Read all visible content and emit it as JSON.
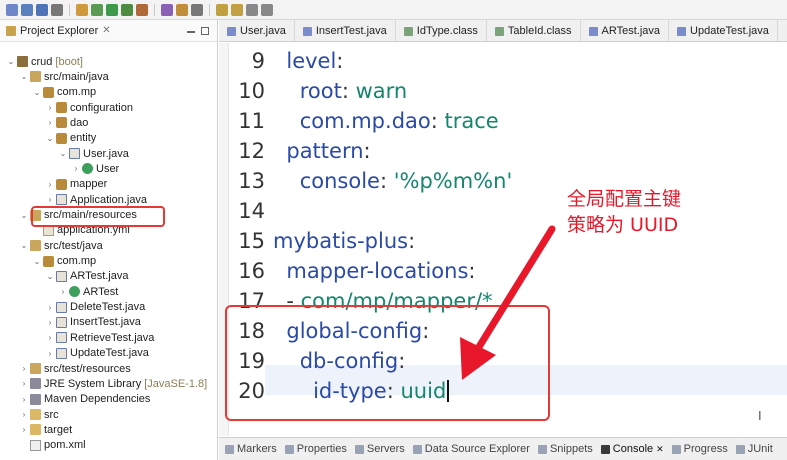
{
  "toolbar": {
    "icons": [
      "new-icon",
      "save-icon",
      "save-all-icon",
      "print-icon",
      "search-icon",
      "debug-icon",
      "run-icon",
      "run-ext-icon",
      "coverage-icon",
      "new-class-icon",
      "open-type-icon",
      "search-menu-icon",
      "next-annotation-icon",
      "prev-annotation-icon",
      "back-icon",
      "forward-icon"
    ]
  },
  "explorer": {
    "title": "Project Explorer",
    "close_symbol": "✕",
    "items": [
      {
        "label": "crud",
        "suffix": "[boot]",
        "icon": "project-icon",
        "chev": "⌄",
        "depth": 0,
        "name": "tree-crud-project"
      },
      {
        "label": "src/main/java",
        "icon": "source-folder-icon",
        "chev": "⌄",
        "depth": 1,
        "name": "tree-src-main-java"
      },
      {
        "label": "com.mp",
        "icon": "package-icon",
        "chev": "⌄",
        "depth": 2,
        "name": "tree-package-com-mp"
      },
      {
        "label": "configuration",
        "icon": "package-icon",
        "chev": "›",
        "depth": 3,
        "name": "tree-package-configuration"
      },
      {
        "label": "dao",
        "icon": "package-icon",
        "chev": "›",
        "depth": 3,
        "name": "tree-package-dao"
      },
      {
        "label": "entity",
        "icon": "package-icon",
        "chev": "⌄",
        "depth": 3,
        "name": "tree-package-entity"
      },
      {
        "label": "User.java",
        "icon": "java-file-icon",
        "chev": "⌄",
        "depth": 4,
        "name": "tree-file-user-java"
      },
      {
        "label": "User",
        "icon": "class-icon",
        "chev": "›",
        "depth": 5,
        "name": "tree-class-user"
      },
      {
        "label": "mapper",
        "icon": "package-icon",
        "chev": "›",
        "depth": 3,
        "name": "tree-package-mapper"
      },
      {
        "label": "Application.java",
        "icon": "java-file-icon",
        "chev": "›",
        "depth": 3,
        "name": "tree-file-application-java"
      },
      {
        "label": "src/main/resources",
        "icon": "source-folder-icon",
        "chev": "⌄",
        "depth": 1,
        "name": "tree-src-main-resources"
      },
      {
        "label": "application.yml",
        "icon": "yml-file-icon",
        "chev": "",
        "depth": 2,
        "name": "tree-file-application-yml"
      },
      {
        "label": "src/test/java",
        "icon": "source-folder-icon",
        "chev": "⌄",
        "depth": 1,
        "name": "tree-src-test-java"
      },
      {
        "label": "com.mp",
        "icon": "package-icon",
        "chev": "⌄",
        "depth": 2,
        "name": "tree-package-com-mp-test"
      },
      {
        "label": "ARTest.java",
        "icon": "java-file-icon",
        "chev": "⌄",
        "depth": 3,
        "name": "tree-file-artest-java"
      },
      {
        "label": "ARTest",
        "icon": "class-icon",
        "chev": "›",
        "depth": 4,
        "name": "tree-class-artest"
      },
      {
        "label": "DeleteTest.java",
        "icon": "java-file-icon",
        "chev": "›",
        "depth": 3,
        "name": "tree-file-deletetest-java"
      },
      {
        "label": "InsertTest.java",
        "icon": "java-file-icon",
        "chev": "›",
        "depth": 3,
        "name": "tree-file-inserttest-java"
      },
      {
        "label": "RetrieveTest.java",
        "icon": "java-file-icon",
        "chev": "›",
        "depth": 3,
        "name": "tree-file-retrievetest-java"
      },
      {
        "label": "UpdateTest.java",
        "icon": "java-file-icon",
        "chev": "›",
        "depth": 3,
        "name": "tree-file-updatetest-java"
      },
      {
        "label": "src/test/resources",
        "icon": "source-folder-icon",
        "chev": "›",
        "depth": 1,
        "name": "tree-src-test-resources"
      },
      {
        "label": "JRE System Library",
        "suffix": "[JavaSE-1.8]",
        "icon": "library-icon",
        "chev": "›",
        "depth": 1,
        "name": "tree-jre-library"
      },
      {
        "label": "Maven Dependencies",
        "icon": "library-icon",
        "chev": "›",
        "depth": 1,
        "name": "tree-maven-dependencies"
      },
      {
        "label": "src",
        "icon": "folder-icon",
        "chev": "›",
        "depth": 1,
        "name": "tree-folder-src"
      },
      {
        "label": "target",
        "icon": "folder-icon",
        "chev": "›",
        "depth": 1,
        "name": "tree-folder-target"
      },
      {
        "label": "pom.xml",
        "icon": "xml-file-icon",
        "chev": "",
        "depth": 1,
        "name": "tree-file-pom-xml"
      }
    ]
  },
  "editor": {
    "tabs": [
      {
        "label": "User.java",
        "icon": "java-file-icon"
      },
      {
        "label": "InsertTest.java",
        "icon": "java-file-icon"
      },
      {
        "label": "IdType.class",
        "icon": "class-file-icon"
      },
      {
        "label": "TableId.class",
        "icon": "class-file-icon"
      },
      {
        "label": "ARTest.java",
        "icon": "java-file-icon"
      },
      {
        "label": "UpdateTest.java",
        "icon": "java-file-icon"
      }
    ],
    "lines": [
      {
        "num": "9",
        "indent": "  ",
        "key": "level",
        "sep": ":",
        "value": ""
      },
      {
        "num": "10",
        "indent": "    ",
        "key": "root",
        "sep": ": ",
        "value": "warn"
      },
      {
        "num": "11",
        "indent": "    ",
        "key": "com.mp.dao",
        "sep": ": ",
        "value": "trace"
      },
      {
        "num": "12",
        "indent": "  ",
        "key": "pattern",
        "sep": ":",
        "value": ""
      },
      {
        "num": "13",
        "indent": "    ",
        "key": "console",
        "sep": ": ",
        "value": "'%p%m%n'"
      },
      {
        "num": "14",
        "indent": "",
        "key": "",
        "sep": "",
        "value": ""
      },
      {
        "num": "15",
        "indent": "",
        "key": "mybatis-plus",
        "sep": ":",
        "value": ""
      },
      {
        "num": "16",
        "indent": "  ",
        "key": "mapper-locations",
        "sep": ":",
        "value": ""
      },
      {
        "num": "17",
        "indent": "  ",
        "key": "",
        "sep": "- ",
        "value": "com/mp/mapper/*"
      },
      {
        "num": "18",
        "indent": "  ",
        "key": "global-config",
        "sep": ":",
        "value": ""
      },
      {
        "num": "19",
        "indent": "    ",
        "key": "db-config",
        "sep": ":",
        "value": ""
      },
      {
        "num": "20",
        "indent": "      ",
        "key": "id-type",
        "sep": ": ",
        "value": "uuid"
      }
    ],
    "annotation_line1": "全局配置主键",
    "annotation_line2": "策略为 UUID",
    "ibeam": "I"
  },
  "bottom_tabs": [
    {
      "label": "Markers",
      "active": false
    },
    {
      "label": "Properties",
      "active": false
    },
    {
      "label": "Servers",
      "active": false
    },
    {
      "label": "Data Source Explorer",
      "active": false
    },
    {
      "label": "Snippets",
      "active": false
    },
    {
      "label": "Console",
      "active": true,
      "close": "✕"
    },
    {
      "label": "Progress",
      "active": false
    },
    {
      "label": "JUnit",
      "active": false
    }
  ],
  "colors": {
    "highlight_red": "#e53935",
    "yaml_key": "#2a4aa8",
    "yaml_value": "#14866d"
  }
}
